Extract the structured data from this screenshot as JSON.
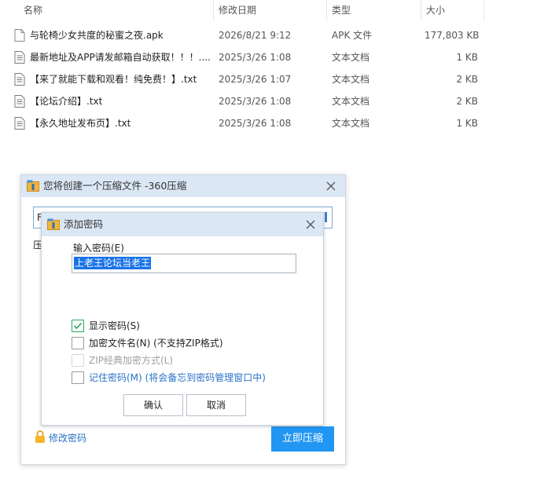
{
  "file_list": {
    "columns": [
      {
        "label": "名称"
      },
      {
        "label": "修改日期"
      },
      {
        "label": "类型"
      },
      {
        "label": "大小"
      }
    ],
    "sort_indicator": "^",
    "files": [
      {
        "name": "与轮椅少女共度的秘蜜之夜.apk",
        "date": "2026/8/21 9:12",
        "type": "APK 文件",
        "size": "177,803 KB",
        "icon": "file-generic-icon"
      },
      {
        "name": "最新地址及APP请发邮箱自动获取！！！....",
        "date": "2025/3/26 1:08",
        "type": "文本文档",
        "size": "1 KB",
        "icon": "text-file-icon"
      },
      {
        "name": "【来了就能下载和观看！纯免费！】.txt",
        "date": "2025/3/26 1:07",
        "type": "文本文档",
        "size": "2 KB",
        "icon": "text-file-icon"
      },
      {
        "name": "【论坛介绍】.txt",
        "date": "2025/3/26 1:08",
        "type": "文本文档",
        "size": "2 KB",
        "icon": "text-file-icon"
      },
      {
        "name": "【永久地址发布页】.txt",
        "date": "2025/3/26 1:08",
        "type": "文本文档",
        "size": "1 KB",
        "icon": "text-file-icon"
      }
    ]
  },
  "main_dialog": {
    "title": "您将创建一个压缩文件 -360压缩",
    "input_partial": "F",
    "label_partial": "压",
    "modify_password_link": "修改密码",
    "compress_button": "立即压缩"
  },
  "password_dialog": {
    "title": "添加密码",
    "input_label": "输入密码(E)",
    "password_value": "上老王论坛当老王",
    "options": [
      {
        "label": "显示密码(S)",
        "checked": true,
        "disabled": false,
        "accent": false
      },
      {
        "label": "加密文件名(N) (不支持ZIP格式)",
        "checked": false,
        "disabled": false,
        "accent": false
      },
      {
        "label": "ZIP经典加密方式(L)",
        "checked": false,
        "disabled": true,
        "accent": false
      },
      {
        "label": "记住密码(M) (将会备忘到密码管理窗口中)",
        "checked": false,
        "disabled": false,
        "accent": true
      }
    ],
    "ok_button": "确认",
    "cancel_button": "取消"
  },
  "colors": {
    "accent_blue": "#2196f3",
    "link_blue": "#2a72c8",
    "title_bar": "#dbe7f5",
    "check_green": "#2aa55a",
    "selection": "#1a73e8"
  }
}
